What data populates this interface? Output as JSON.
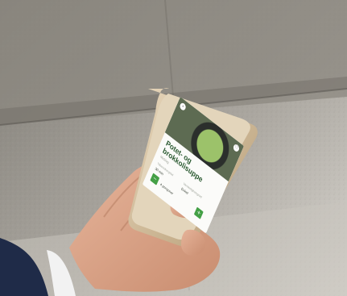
{
  "recipe": {
    "title": "Potet- og\nbrokkolisuppe",
    "subtitle": "Middag",
    "time_label": "Tilberedningstid",
    "time_value": "30 min",
    "difficulty_label": "Vanskelighetsgrad",
    "difficulty_value": "Enkel",
    "portions": "4 porsjoner",
    "minus_icon": "minus-icon",
    "plus_icon": "plus-icon"
  },
  "colors": {
    "accent_green": "#44a046",
    "title_green": "#2b5a31",
    "phone_gold": "#cbb38c"
  }
}
